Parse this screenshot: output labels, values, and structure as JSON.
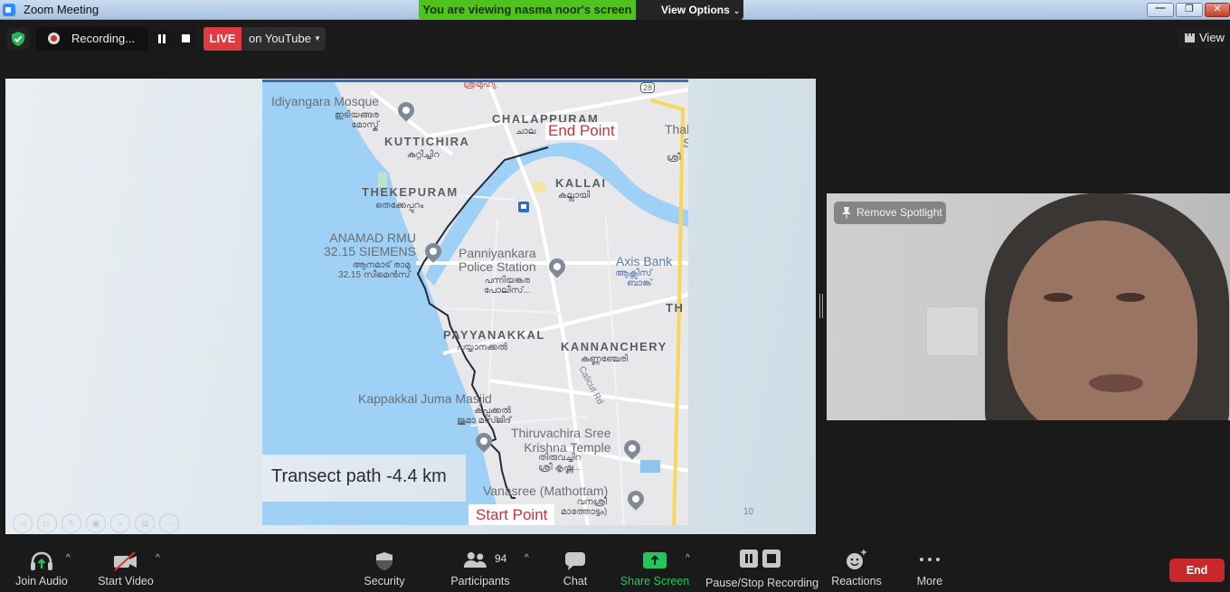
{
  "window": {
    "title": "Zoom Meeting",
    "controls": {
      "minimize": "—",
      "maximize": "❐",
      "close": "✕"
    }
  },
  "share_banner": {
    "text": "You are viewing nasma noor's screen",
    "view_options_label": "View Options",
    "view_options_chevron": "⌄",
    "banner_color": "#4fc21b"
  },
  "top_bar": {
    "security_icon": "shield-check-icon",
    "recording_label": "Recording...",
    "live_label": "LIVE",
    "live_destination": "on YouTube",
    "live_caret": "▼",
    "view_label": "View",
    "live_color": "#e0393e"
  },
  "slide": {
    "nav_buttons": [
      "◁",
      "▷",
      "✎",
      "▣",
      "⌕",
      "▤",
      "···"
    ],
    "page_number": "10",
    "map": {
      "end_point_label": "End Point",
      "start_point_label": "Start Point",
      "transect_label": "Transect path -4.4 km",
      "highway_shield": "28",
      "districts": [
        {
          "en": "CHALAPPURAM",
          "ml": "ചാല"
        },
        {
          "en": "KUTTICHIRA",
          "ml": "കുറ്റിച്ചിറ"
        },
        {
          "en": "KALLAI",
          "ml": "കല്ലായി"
        },
        {
          "en": "THEKEPURAM",
          "ml": "തെക്കേപ്പുറം"
        },
        {
          "en": "PAYYANAKKAL",
          "ml": "പയ്യാനക്കൽ"
        },
        {
          "en": "KANNANCHERY",
          "ml": "കണ്ണഞ്ചേരി"
        }
      ],
      "pois": [
        {
          "en": "Idiyangara Mosque",
          "ml": "ഇടിയങ്ങര\nമോസ്ക്"
        },
        {
          "en": "ANAMAD RMU\n32.15 SIEMENS",
          "ml": "ആനമാട് രാമു\n32.15 സീമെൻസ്"
        },
        {
          "en": "Panniyankara\nPolice Station",
          "ml": "പന്നിയങ്കര\nപോലീസ്..."
        },
        {
          "en": "Axis Bank",
          "ml": "ആക്സിസ്\nബാങ്ക്"
        },
        {
          "en": "Kappakkal Juma Masjid",
          "ml": "കപ്പക്കൽ\nജുമാ മസ്ജിദ്"
        },
        {
          "en": "Thiruvachira Sree\nKrishna Temple",
          "ml": "തിരുവച്ചിറ\nശ്രീ കൃഷ്ണ..."
        },
        {
          "en": "Vanasree (Mathottam)",
          "ml": "വനശ്രീ\nമാത്തോട്ടം)"
        },
        {
          "en": "Thalik\nSh",
          "ml": "ശ്രീ"
        }
      ],
      "road_label": "Calicut Rd",
      "partial_label_th": "TH",
      "top_partial_label": "ശ്രീമുഹ്യ"
    }
  },
  "video_tile": {
    "remove_spotlight_label": "Remove Spotlight"
  },
  "toolbar": {
    "items": [
      {
        "label": "Join Audio",
        "icon": "headphones-icon",
        "has_caret": true
      },
      {
        "label": "Start Video",
        "icon": "video-off-icon",
        "has_caret": true
      },
      {
        "label": "Security",
        "icon": "shield-icon",
        "has_caret": false
      },
      {
        "label": "Participants",
        "icon": "participants-icon",
        "count": "94",
        "has_caret": true
      },
      {
        "label": "Chat",
        "icon": "chat-icon",
        "has_caret": false
      },
      {
        "label": "Share Screen",
        "icon": "share-screen-icon",
        "has_caret": true
      },
      {
        "label": "Pause/Stop Recording",
        "icon": "pause-stop-icon",
        "has_caret": false
      },
      {
        "label": "Reactions",
        "icon": "reactions-icon",
        "has_caret": false
      },
      {
        "label": "More",
        "icon": "more-icon",
        "has_caret": false
      }
    ],
    "caret": "^",
    "end_label": "End",
    "share_color": "#22c55e",
    "end_color": "#c8282c"
  }
}
